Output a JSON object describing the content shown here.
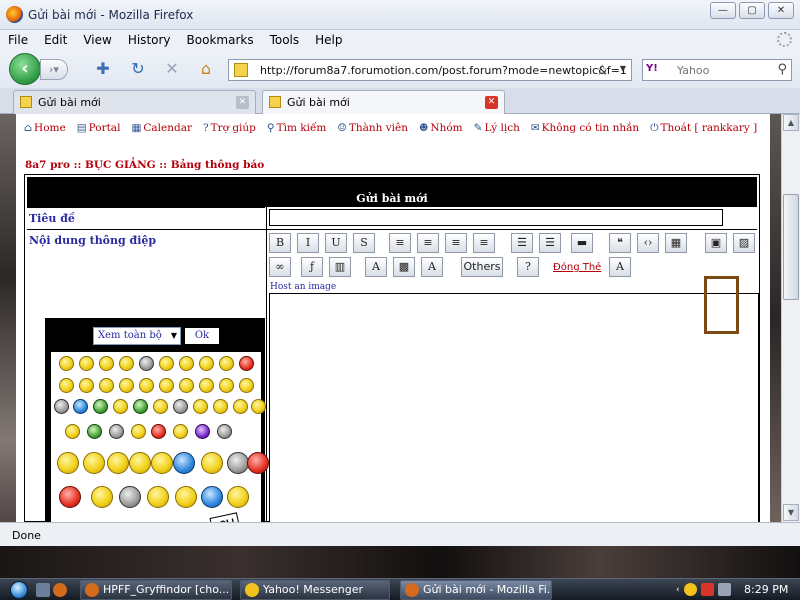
{
  "window": {
    "title": "Gửi bài mới - Mozilla Firefox"
  },
  "menu": [
    "File",
    "Edit",
    "View",
    "History",
    "Bookmarks",
    "Tools",
    "Help"
  ],
  "nav": {
    "url": "http://forum8a7.forumotion.com/post.forum?mode=newtopic&f=1",
    "search_placeholder": "Yahoo",
    "search_engine_label": "Y!"
  },
  "tabs": [
    {
      "label": "Gửi bài mới",
      "active": false
    },
    {
      "label": "Gửi bài mới",
      "active": true
    }
  ],
  "site_nav": [
    {
      "icon": "home-icon",
      "glyph": "⌂",
      "label": "Home"
    },
    {
      "icon": "portal-icon",
      "glyph": "▤",
      "label": "Portal"
    },
    {
      "icon": "calendar-icon",
      "glyph": "▦",
      "label": "Calendar"
    },
    {
      "icon": "help-icon",
      "glyph": "?",
      "label": "Trợ giúp"
    },
    {
      "icon": "search-icon",
      "glyph": "⚲",
      "label": "Tìm kiếm"
    },
    {
      "icon": "members-icon",
      "glyph": "☺",
      "label": "Thành viên"
    },
    {
      "icon": "groups-icon",
      "glyph": "☻",
      "label": "Nhóm"
    },
    {
      "icon": "profile-icon",
      "glyph": "✎",
      "label": "Lý lịch"
    },
    {
      "icon": "messages-icon",
      "glyph": "✉",
      "label": "Không có tin nhắn"
    },
    {
      "icon": "logout-icon",
      "glyph": "⏻",
      "label": "Thoát [ rankkary ]"
    }
  ],
  "breadcrumb": "8a7 pro  :: BỤC GIẢNG :: Bảng thông báo",
  "form": {
    "header": "Gửi bài mới",
    "subject_label": "Tiêu đề",
    "subject_value": "",
    "message_label": "Nội dung thông điệp",
    "message_value": "",
    "host_image_label": "Host an image"
  },
  "toolbar": {
    "row1": [
      {
        "name": "bold-button",
        "glyph": "B"
      },
      {
        "name": "italic-button",
        "glyph": "I"
      },
      {
        "name": "underline-button",
        "glyph": "U"
      },
      {
        "name": "strikethrough-button",
        "glyph": "S"
      },
      {
        "name": "align-left-button",
        "glyph": "≡"
      },
      {
        "name": "align-center-button",
        "glyph": "≡"
      },
      {
        "name": "align-right-button",
        "glyph": "≡"
      },
      {
        "name": "justify-button",
        "glyph": "≡"
      },
      {
        "name": "bullet-list-button",
        "glyph": "☰"
      },
      {
        "name": "numbered-list-button",
        "glyph": "☰"
      },
      {
        "name": "horizontal-rule-button",
        "glyph": "▬"
      },
      {
        "name": "quote-button",
        "glyph": "❝"
      },
      {
        "name": "code-button",
        "glyph": "‹›"
      },
      {
        "name": "table-button",
        "glyph": "▦"
      },
      {
        "name": "host-image-button",
        "glyph": "▣"
      },
      {
        "name": "insert-image-button",
        "glyph": "▨"
      }
    ],
    "row2": [
      {
        "name": "link-button",
        "glyph": "∞"
      },
      {
        "name": "flash-button",
        "glyph": "ƒ"
      },
      {
        "name": "video-button",
        "glyph": "▥"
      },
      {
        "name": "font-color-button",
        "glyph": "A"
      },
      {
        "name": "color-picker-button",
        "glyph": "▩"
      },
      {
        "name": "font-face-button",
        "glyph": "A"
      },
      {
        "name": "others-button",
        "glyph": "Others"
      },
      {
        "name": "spellcheck-button",
        "glyph": "?"
      },
      {
        "name": "font-size-button",
        "glyph": "A"
      }
    ],
    "topic_link": "Đóng Thẻ"
  },
  "smilies": {
    "select_value": "Xem toàn bộ",
    "ok_label": "Ok",
    "lol_text": "LOL!"
  },
  "status": "Done",
  "taskbar": {
    "buttons": [
      "HPFF_Gryffindor [cho...",
      "Yahoo! Messenger",
      "Gửi bài mới - Mozilla Fi..."
    ],
    "clock": "8:29 PM"
  }
}
